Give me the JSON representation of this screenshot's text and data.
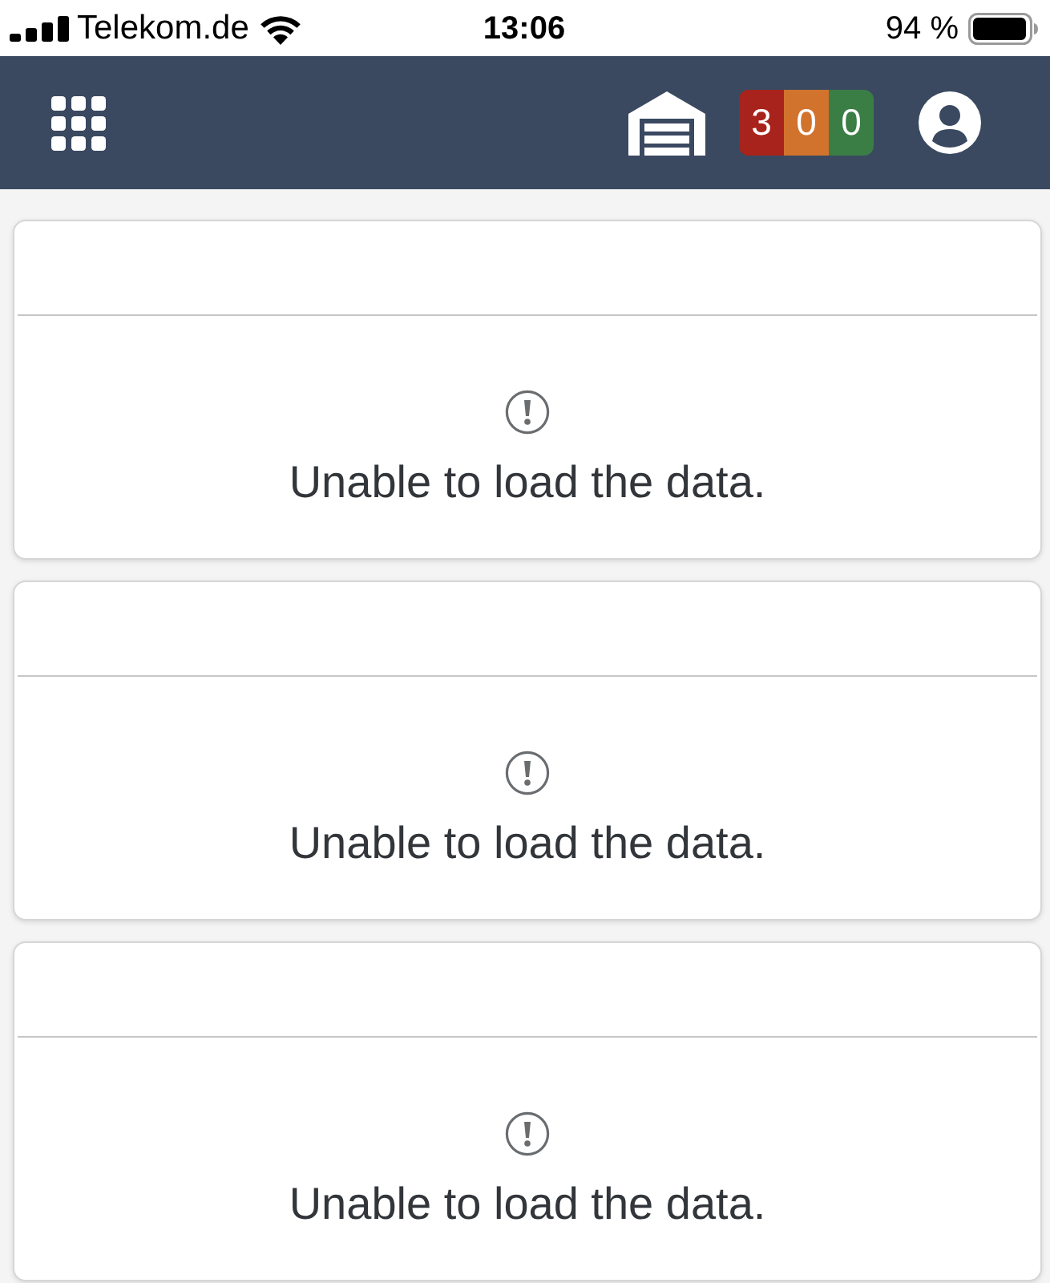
{
  "status_bar": {
    "carrier": "Telekom.de",
    "time": "13:06",
    "battery": "94 %"
  },
  "header": {
    "counters": [
      {
        "value": "3",
        "color": "#a8231b"
      },
      {
        "value": "0",
        "color": "#d1732c"
      },
      {
        "value": "0",
        "color": "#3a7d45"
      }
    ]
  },
  "cards": [
    {
      "message": "Unable to load the data."
    },
    {
      "message": "Unable to load the data."
    },
    {
      "message": "Unable to load the data."
    }
  ]
}
